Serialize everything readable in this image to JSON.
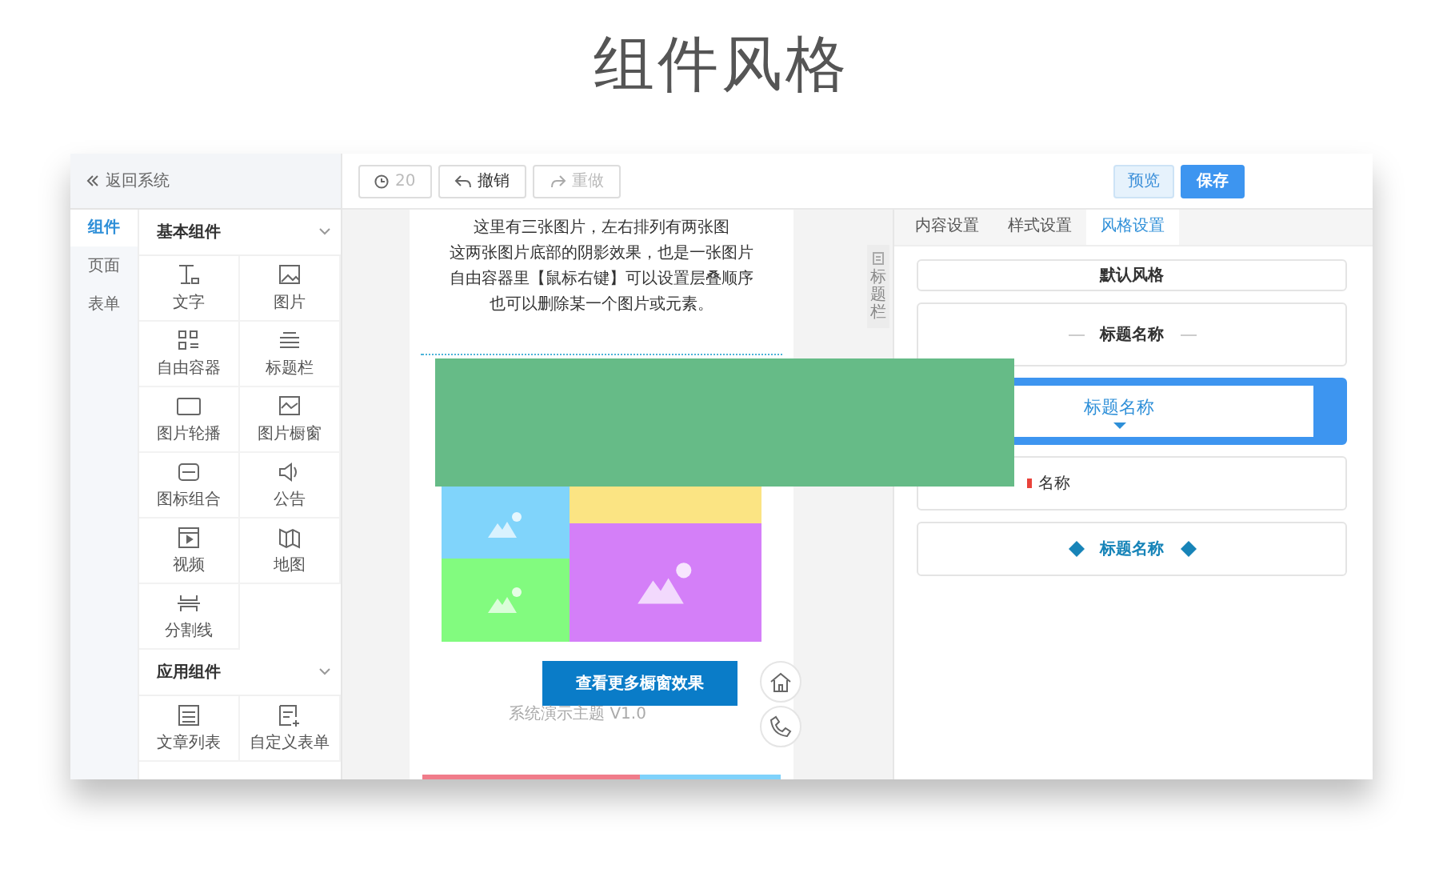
{
  "heading": "组件风格",
  "sidebar": {
    "back_label": "返回系统",
    "tabs": [
      {
        "label": "组件",
        "selected": true
      },
      {
        "label": "页面",
        "selected": false
      },
      {
        "label": "表单",
        "selected": false
      }
    ],
    "groups": [
      {
        "title": "基本组件",
        "expanded": true,
        "items": [
          {
            "label": "文字"
          },
          {
            "label": "图片"
          },
          {
            "label": "自由容器"
          },
          {
            "label": "标题栏"
          },
          {
            "label": "图片轮播"
          },
          {
            "label": "图片橱窗"
          },
          {
            "label": "图标组合"
          },
          {
            "label": "公告"
          },
          {
            "label": "视频"
          },
          {
            "label": "地图"
          },
          {
            "label": "分割线"
          }
        ]
      },
      {
        "title": "应用组件",
        "expanded": true,
        "items": [
          {
            "label": "文章列表"
          },
          {
            "label": "自定义表单"
          }
        ]
      }
    ]
  },
  "toolbar": {
    "history_count": "20",
    "undo": {
      "label": "撤销",
      "disabled": false
    },
    "redo": {
      "label": "重做",
      "disabled": true
    },
    "preview": "预览",
    "save": "保存"
  },
  "canvas": {
    "lines": [
      "这里有三张图片，左右排列有两张图",
      "这两张图片底部的阴影效果，也是一张图片",
      "自由容器里【鼠标右键】可以设置层叠顺序",
      "也可以删除某一个图片或元素。"
    ],
    "tiles": [
      {
        "color": "#80d4fb"
      },
      {
        "color": "#fbe483"
      },
      {
        "color": "#82fb7f"
      },
      {
        "color": "#d47ff8"
      }
    ],
    "button": "查看更多橱窗效果",
    "footer": "系统演示主题 V1.0",
    "side_tab": "标题栏",
    "bottom_bars": [
      {
        "color": "#f07c8a"
      },
      {
        "color": "#7fd2fb"
      }
    ]
  },
  "panel": {
    "tabs": [
      {
        "label": "内容设置",
        "selected": false
      },
      {
        "label": "样式设置",
        "selected": false
      },
      {
        "label": "风格设置",
        "selected": true
      }
    ],
    "styles": [
      {
        "kind": "plain",
        "label": "默认风格",
        "selected": false
      },
      {
        "kind": "lines",
        "label": "标题名称",
        "selected": false
      },
      {
        "kind": "arrow",
        "label": "标题名称",
        "selected": true
      },
      {
        "kind": "dot",
        "label": "名称",
        "selected": false
      },
      {
        "kind": "diamonds",
        "label": "标题名称",
        "selected": false
      }
    ]
  }
}
